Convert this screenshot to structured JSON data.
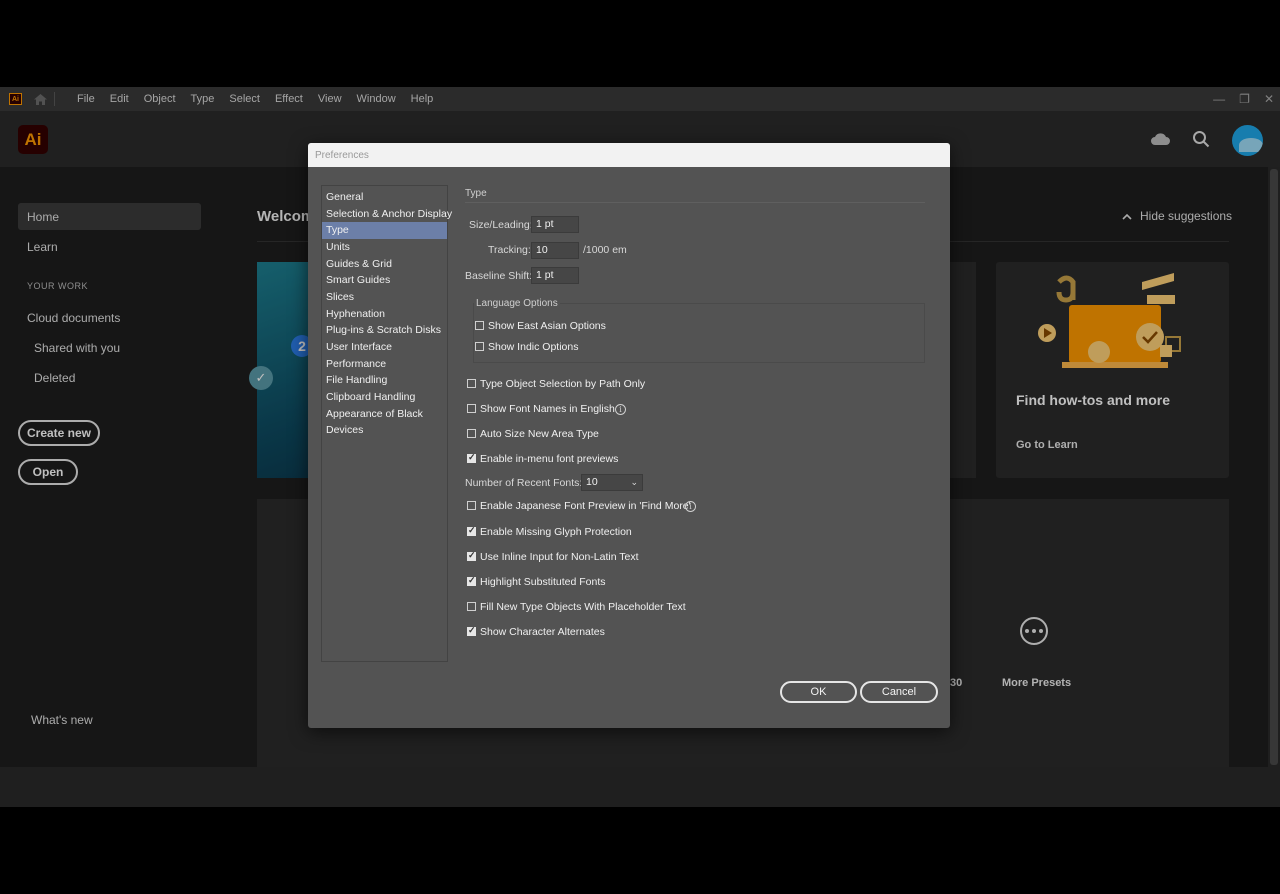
{
  "menubar": {
    "app_badge": "Ai",
    "menus": [
      "File",
      "Edit",
      "Object",
      "Type",
      "Select",
      "Effect",
      "View",
      "Window",
      "Help"
    ]
  },
  "header": {
    "logo": "Ai"
  },
  "sidebar": {
    "home": "Home",
    "learn": "Learn",
    "your_work": "YOUR WORK",
    "cloud_documents": "Cloud documents",
    "shared_with_you": "Shared with you",
    "deleted": "Deleted",
    "create_new": "Create new",
    "open": "Open",
    "whats_new": "What's new"
  },
  "main": {
    "welcome": "Welcom",
    "hide_suggestions": "Hide suggestions",
    "card_step_number": "2",
    "learn_card_title": "Find how-tos and more",
    "learn_card_link": "Go to Learn",
    "more_presets": "More Presets",
    "trailing_text": "30"
  },
  "dialog": {
    "title": "Preferences",
    "categories": [
      "General",
      "Selection & Anchor Display",
      "Type",
      "Units",
      "Guides & Grid",
      "Smart Guides",
      "Slices",
      "Hyphenation",
      "Plug-ins & Scratch Disks",
      "User Interface",
      "Performance",
      "File Handling",
      "Clipboard Handling",
      "Appearance of Black",
      "Devices"
    ],
    "selected_category": "Type",
    "panel_title": "Type",
    "size_leading_label": "Size/Leading:",
    "size_leading_value": "1 pt",
    "tracking_label": "Tracking:",
    "tracking_value": "10",
    "tracking_unit": "/1000 em",
    "baseline_shift_label": "Baseline Shift:",
    "baseline_shift_value": "1 pt",
    "language_options_label": "Language Options",
    "show_east_asian": {
      "label": "Show East Asian Options",
      "checked": false
    },
    "show_indic": {
      "label": "Show Indic Options",
      "checked": false
    },
    "type_object_selection": {
      "label": "Type Object Selection by Path Only",
      "checked": false
    },
    "show_font_names_english": {
      "label": "Show Font Names in English",
      "checked": false
    },
    "auto_size_area_type": {
      "label": "Auto Size New Area Type",
      "checked": false
    },
    "enable_in_menu_previews": {
      "label": "Enable in-menu font previews",
      "checked": true
    },
    "recent_fonts_label": "Number of Recent Fonts:",
    "recent_fonts_value": "10",
    "enable_japanese_preview": {
      "label": "Enable Japanese Font Preview in 'Find More'",
      "checked": false
    },
    "missing_glyph_protection": {
      "label": "Enable Missing Glyph Protection",
      "checked": true
    },
    "inline_input_non_latin": {
      "label": "Use Inline Input for Non-Latin Text",
      "checked": true
    },
    "highlight_substituted": {
      "label": "Highlight Substituted Fonts",
      "checked": true
    },
    "fill_placeholder": {
      "label": "Fill New Type Objects With Placeholder Text",
      "checked": false
    },
    "show_character_alternates": {
      "label": "Show Character Alternates",
      "checked": true
    },
    "ok": "OK",
    "cancel": "Cancel"
  },
  "colors": {
    "brand_orange": "#ff9a00",
    "brand_dark": "#330000",
    "selection_blue": "#6c7fa8",
    "avatar_blue": "#1fa7e8"
  }
}
